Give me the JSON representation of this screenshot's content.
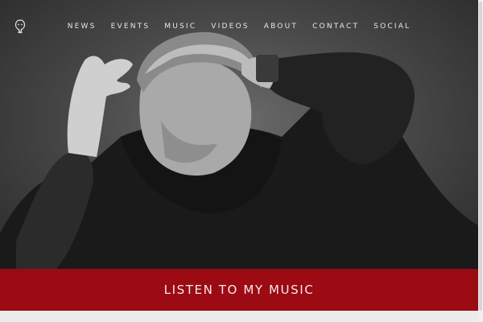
{
  "nav": {
    "left": [
      "NEWS",
      "EVENTS",
      "MUSIC",
      "VIDEOS"
    ],
    "right": [
      "ABOUT",
      "CONTACT",
      "SOCIAL"
    ],
    "logo_icon": "microphone-head-logo-icon"
  },
  "hero": {
    "image": "black-and-white-portrait-man-hands-on-head"
  },
  "cta": {
    "label": "LISTEN TO MY MUSIC",
    "color": "#9c0a14"
  }
}
